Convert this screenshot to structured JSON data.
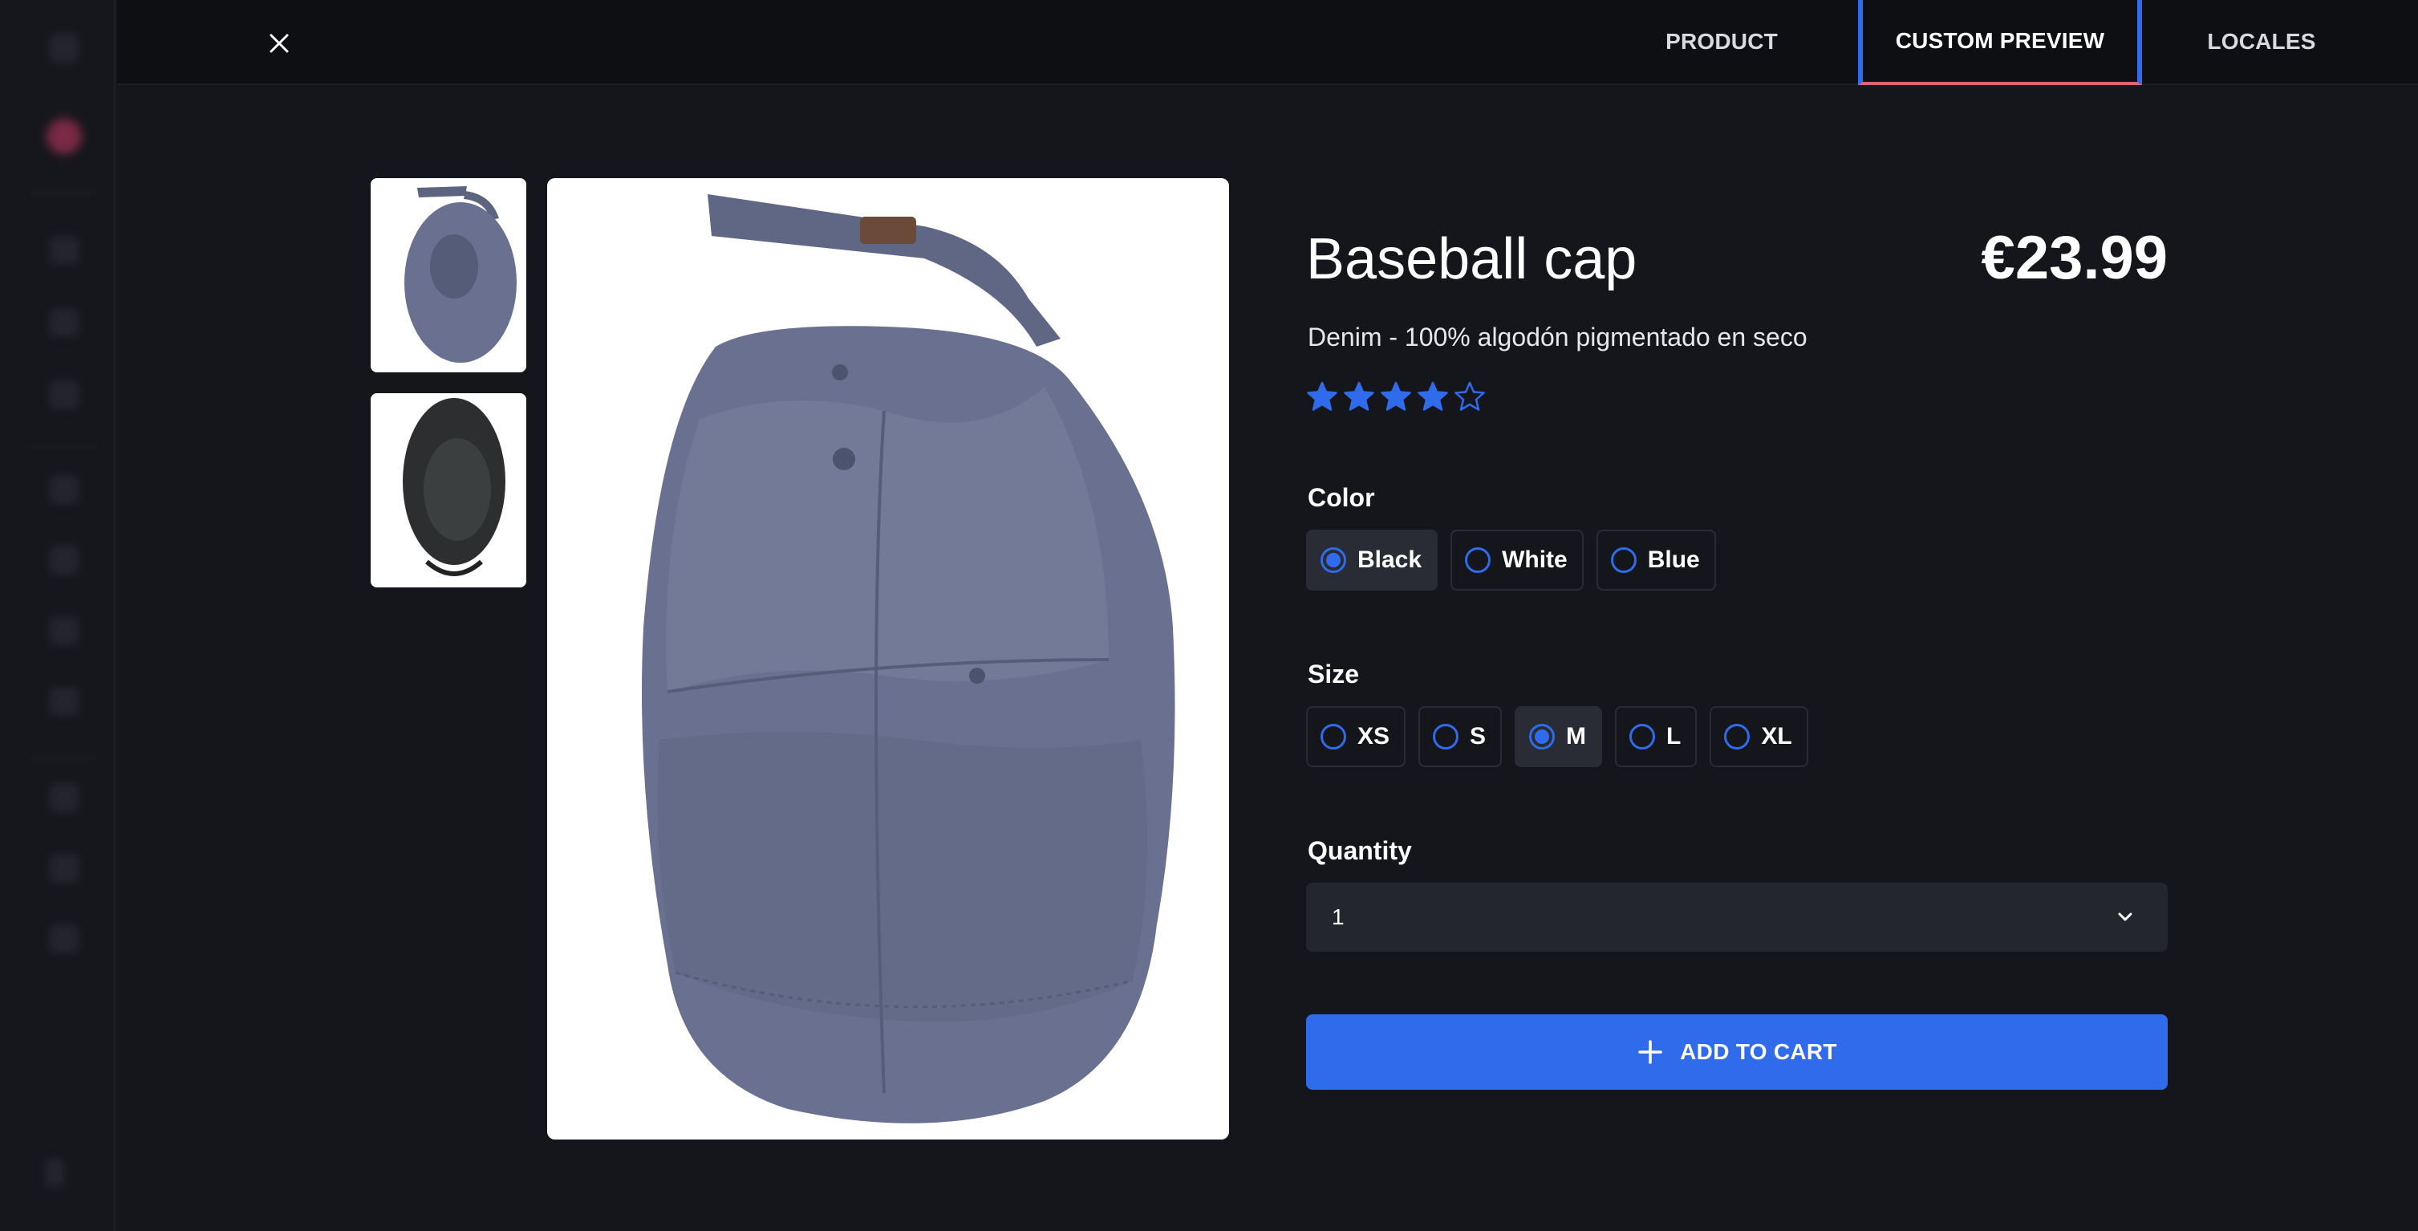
{
  "tabs": [
    {
      "label": "PRODUCT"
    },
    {
      "label": "CUSTOM PREVIEW"
    },
    {
      "label": "LOCALES"
    }
  ],
  "product": {
    "title": "Baseball cap",
    "price": "€23.99",
    "description": "Denim - 100% algodón pigmentado en seco",
    "rating": {
      "value": 4,
      "max": 5
    }
  },
  "color": {
    "label": "Color",
    "options": [
      "Black",
      "White",
      "Blue"
    ],
    "selected": "Black"
  },
  "size": {
    "label": "Size",
    "options": [
      "XS",
      "S",
      "M",
      "L",
      "XL"
    ],
    "selected": "M"
  },
  "quantity": {
    "label": "Quantity",
    "value": "1"
  },
  "add_to_cart": {
    "label": "ADD TO CART"
  },
  "colors": {
    "accent": "#2f6bea",
    "background": "#15161b",
    "topbar": "#0e0f12",
    "tab_underline": "#e0646c"
  },
  "icons": [
    "close-icon",
    "star-icon",
    "chevron-down-icon",
    "plus-icon"
  ]
}
